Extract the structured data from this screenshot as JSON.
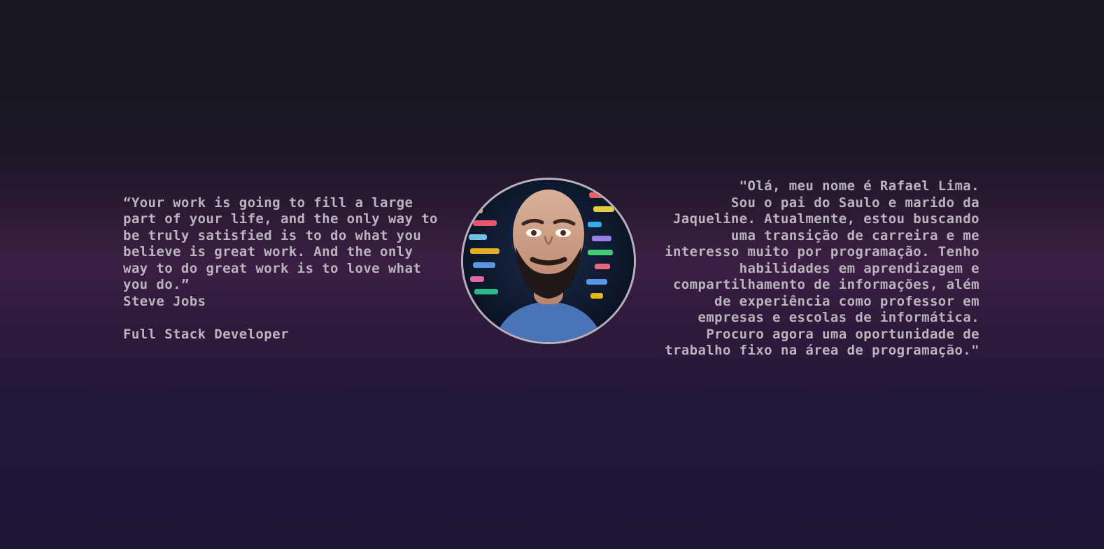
{
  "quote": {
    "text": "“Your work is going to fill a large part of your life, and the only way to be truly satisfied is to do what you believe is great work. And the only way to do great work is to love what you do.”",
    "author": "Steve Jobs",
    "role": "Full Stack Developer"
  },
  "about": {
    "text": "\"Olá, meu nome é Rafael Lima.\nSou o pai do Saulo e marido da Jaqueline. Atualmente, estou buscando uma transição de carreira e me interesso muito por programação. Tenho habilidades em aprendizagem e compartilhamento de informações, além de experiência como professor em empresas e escolas de informática. Procuro agora uma oportunidade de trabalho fixo na área de programação.\""
  },
  "avatar": {
    "icon": "profile-photo"
  },
  "colors": {
    "text": "#b9b4bd",
    "border": "#b8b1bd"
  }
}
